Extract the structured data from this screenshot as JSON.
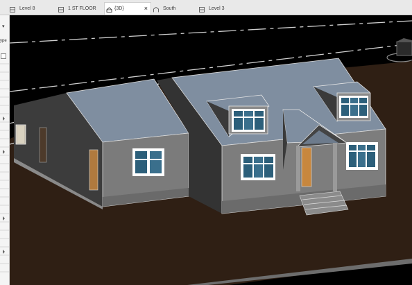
{
  "tabs": [
    {
      "label": "Level 8",
      "icon": "floor-plan-icon",
      "active": false
    },
    {
      "label": "1 ST FLOOR",
      "icon": "floor-plan-icon",
      "active": false
    },
    {
      "label": "{3D}",
      "icon": "3d-house-icon",
      "active": true,
      "close": "×"
    },
    {
      "label": "South",
      "icon": "elevation-icon",
      "active": false
    },
    {
      "label": "Level 3",
      "icon": "floor-plan-icon",
      "active": false
    }
  ],
  "left_panel": {
    "type_label": "ype",
    "collapse_arrow": "▾"
  },
  "colors": {
    "sky": "#000000",
    "ground": "#2f1f14",
    "roof": "#7f8ea0",
    "wall": "#7a7a7a",
    "wall_dark": "#3a3a3a",
    "door": "#c8873e",
    "window_glass": "#2c5f7a"
  }
}
